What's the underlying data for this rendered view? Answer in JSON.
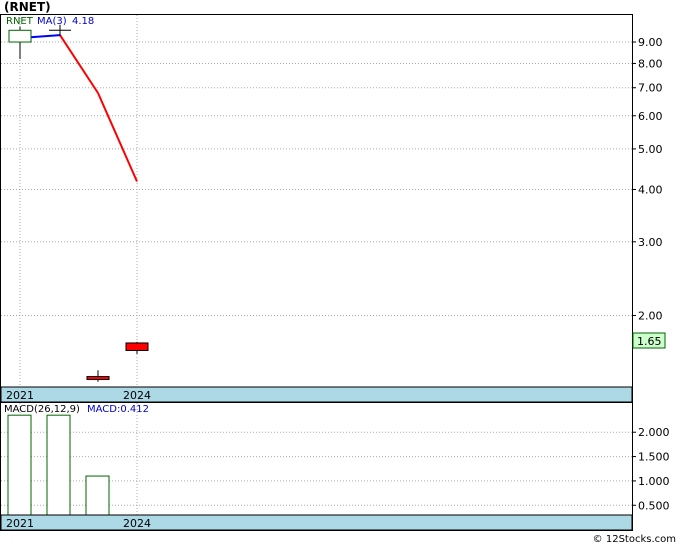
{
  "title": "(RNET)",
  "watermark": "© 12Stocks.com",
  "colors": {
    "axis_band": "#add8e6",
    "ma_line_up": "#0000ff",
    "ma_line_down": "#ff0000",
    "candle_down": "#ff0000",
    "candle_up": "#ffffff",
    "macd_bar_outline": "#006400",
    "ticker_label": "#006400",
    "ma_label": "#0000cd",
    "last_price_bg": "#ccffcc",
    "grid": "#aaaaaa"
  },
  "chart_data": [
    {
      "type": "candlestick",
      "scale": "log",
      "ylim": [
        1.35,
        10.5
      ],
      "ticker_label": "RNET",
      "ma_label": "MA(3)",
      "ma_value_label": "4.18",
      "last_price_label": "1.65",
      "x_labels": [
        "2021",
        "2024"
      ],
      "y_ticks": [
        "9.00",
        "8.00",
        "7.00",
        "6.00",
        "5.00",
        "4.00",
        "3.00",
        "2.00"
      ],
      "candles": [
        {
          "open": 9.0,
          "high": 9.8,
          "low": 8.2,
          "close": 9.6,
          "direction": "up"
        },
        {
          "open": 9.6,
          "high": 9.9,
          "low": 9.3,
          "close": 9.6,
          "direction": "flat"
        },
        {
          "open": 1.43,
          "high": 1.48,
          "low": 1.39,
          "close": 1.43,
          "direction": "down"
        },
        {
          "open": 1.72,
          "high": 1.73,
          "low": 1.62,
          "close": 1.65,
          "direction": "down"
        }
      ],
      "ma_series": [
        {
          "x": 0,
          "value": 9.2
        },
        {
          "x": 1,
          "value": 9.35
        },
        {
          "x": 2,
          "value": 6.8
        },
        {
          "x": 3,
          "value": 4.18
        }
      ]
    },
    {
      "type": "bar",
      "title": "MACD(26,12,9)",
      "value_label": "MACD:0.412",
      "x_labels": [
        "2021",
        "2024"
      ],
      "y_ticks": [
        "2.000",
        "1.500",
        "1.000",
        "0.500"
      ],
      "ylim": [
        0.3,
        2.6
      ],
      "bars": [
        2.35,
        2.35,
        1.1
      ]
    }
  ]
}
